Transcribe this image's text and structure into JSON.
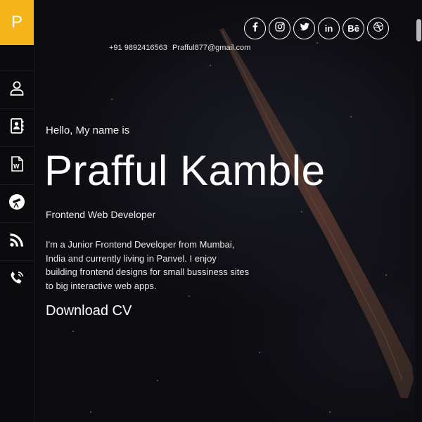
{
  "brand": {
    "logo_letter": "P",
    "accent": "#f7b51c"
  },
  "sidebar": {
    "items": [
      {
        "icon": "user-icon",
        "label": "About"
      },
      {
        "icon": "contact-book-icon",
        "label": "Contact book"
      },
      {
        "icon": "word-document-icon",
        "label": "Resume"
      },
      {
        "icon": "telescope-icon",
        "label": "Portfolio"
      },
      {
        "icon": "rss-icon",
        "label": "Blog"
      },
      {
        "icon": "phone-icon",
        "label": "Call"
      }
    ]
  },
  "social": [
    {
      "icon": "facebook-icon"
    },
    {
      "icon": "instagram-icon"
    },
    {
      "icon": "twitter-icon"
    },
    {
      "icon": "linkedin-icon",
      "text": "in"
    },
    {
      "icon": "behance-icon",
      "text": "Bē"
    },
    {
      "icon": "dribbble-icon"
    }
  ],
  "contact": {
    "phone": "+91 9892416563",
    "email": "Prafful877@gmail.com"
  },
  "hero": {
    "greeting": "Hello, My name is",
    "name": "Prafful Kamble",
    "role": "Frontend Web Developer",
    "bio": "I'm a Junior Frontend Developer from Mumbai, India and currently living in Panvel. I enjoy building frontend designs for small bussiness sites to big interactive web apps.",
    "cta": "Download CV"
  }
}
